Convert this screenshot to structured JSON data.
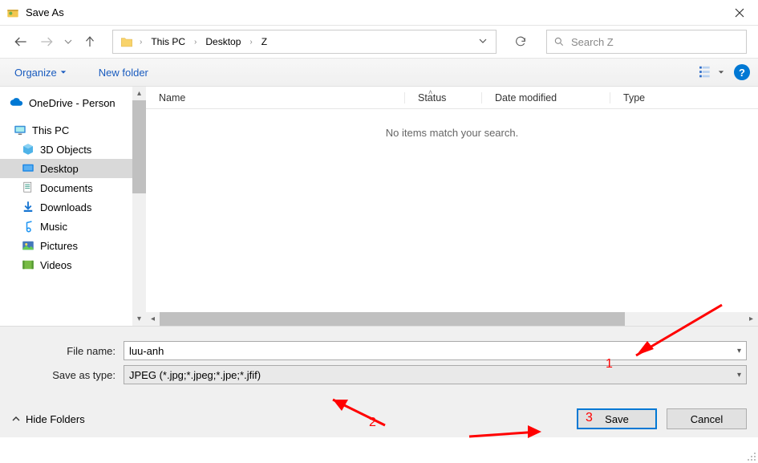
{
  "title": "Save As",
  "breadcrumb": {
    "seg1": "This PC",
    "seg2": "Desktop",
    "seg3": "Z"
  },
  "search": {
    "placeholder": "Search Z"
  },
  "toolbar": {
    "organize": "Organize",
    "newfolder": "New folder"
  },
  "columns": {
    "name": "Name",
    "status": "Status",
    "date": "Date modified",
    "type": "Type"
  },
  "empty_msg": "No items match your search.",
  "sidebar": {
    "onedrive": "OneDrive - Person",
    "thispc": "This PC",
    "objects3d": "3D Objects",
    "desktop": "Desktop",
    "documents": "Documents",
    "downloads": "Downloads",
    "music": "Music",
    "pictures": "Pictures",
    "videos": "Videos"
  },
  "form": {
    "filename_label": "File name:",
    "filename_value": "luu-anh",
    "saveas_label": "Save as type:",
    "saveas_value": "JPEG (*.jpg;*.jpeg;*.jpe;*.jfif)"
  },
  "footer": {
    "hide_folders": "Hide Folders",
    "save": "Save",
    "cancel": "Cancel"
  },
  "annotations": {
    "one": "1",
    "two": "2",
    "three": "3"
  }
}
